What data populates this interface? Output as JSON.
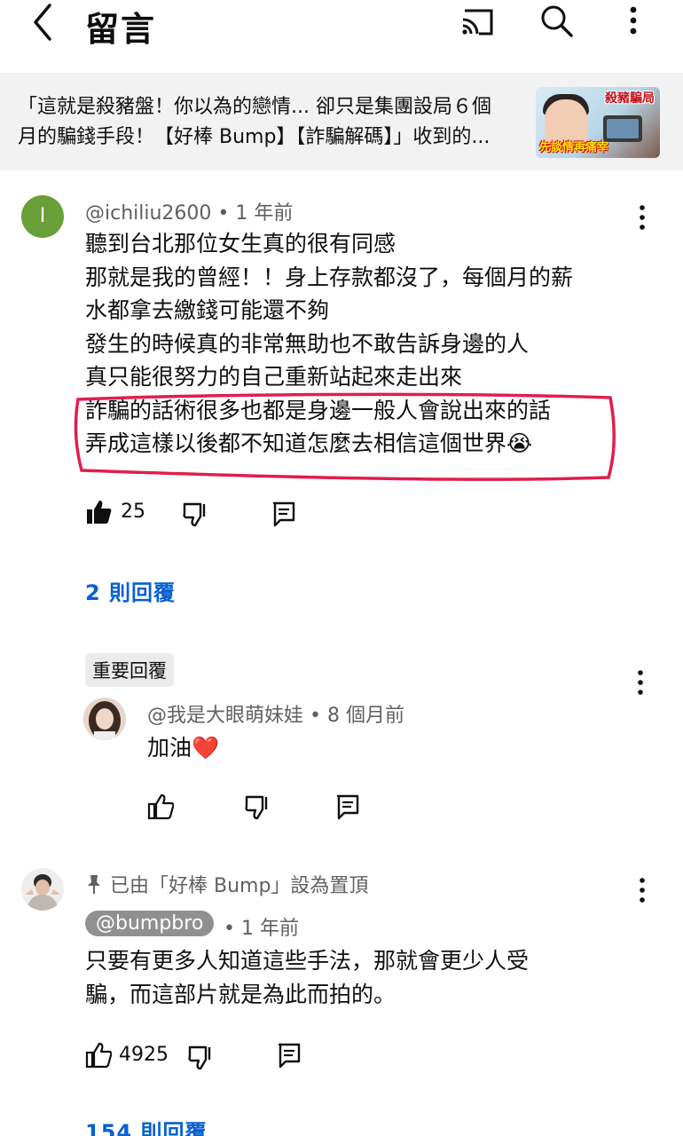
{
  "header": {
    "title": "留言",
    "back_icon": "chevron-left-icon",
    "cast_icon": "cast-icon",
    "search_icon": "search-icon",
    "more_icon": "more-vertical-icon"
  },
  "video": {
    "title_line1": "「這就是殺豬盤！你以為的戀情... 卻只是集團設局６個",
    "title_line2": "月的騙錢手段！【好棒 Bump】【詐騙解碼】」收到的...",
    "thumb_text_top": "殺豬騙局",
    "thumb_text_bottom": "先談情再痛宰"
  },
  "comment1": {
    "avatar_letter": "I",
    "author": "@ichiliu2600",
    "time": "• 1 年前",
    "lines": [
      "聽到台北那位女生真的很有同感",
      "那就是我的曾經！！身上存款都沒了，每個月的薪",
      "水都拿去繳錢可能還不夠",
      "發生的時候真的非常無助也不敢告訴身邊的人",
      "真只能很努力的自己重新站起來走出來",
      "詐騙的話術很多也都是身邊一般人會說出來的話",
      "弄成這樣以後都不知道怎麼去相信這個世界😭"
    ],
    "likes": "25",
    "replies_link": "2 則回覆"
  },
  "reply1": {
    "chip": "重要回覆",
    "author": "@我是大眼萌妹娃",
    "time": "• 8 個月前",
    "text": "加油❤️"
  },
  "comment2": {
    "pinned_text": "已由「好棒 Bump」設為置頂",
    "author": "@bumpbro",
    "time": "• 1 年前",
    "lines": [
      "只要有更多人知道這些手法，那就會更少人受",
      "騙，而這部片就是為此而拍的。"
    ],
    "likes": "4925",
    "replies_link": "154 則回覆"
  },
  "colors": {
    "link_blue": "#065fd4",
    "avatar_green": "#689f38",
    "highlight_red": "#e01e4c",
    "meta_gray": "#606060"
  }
}
